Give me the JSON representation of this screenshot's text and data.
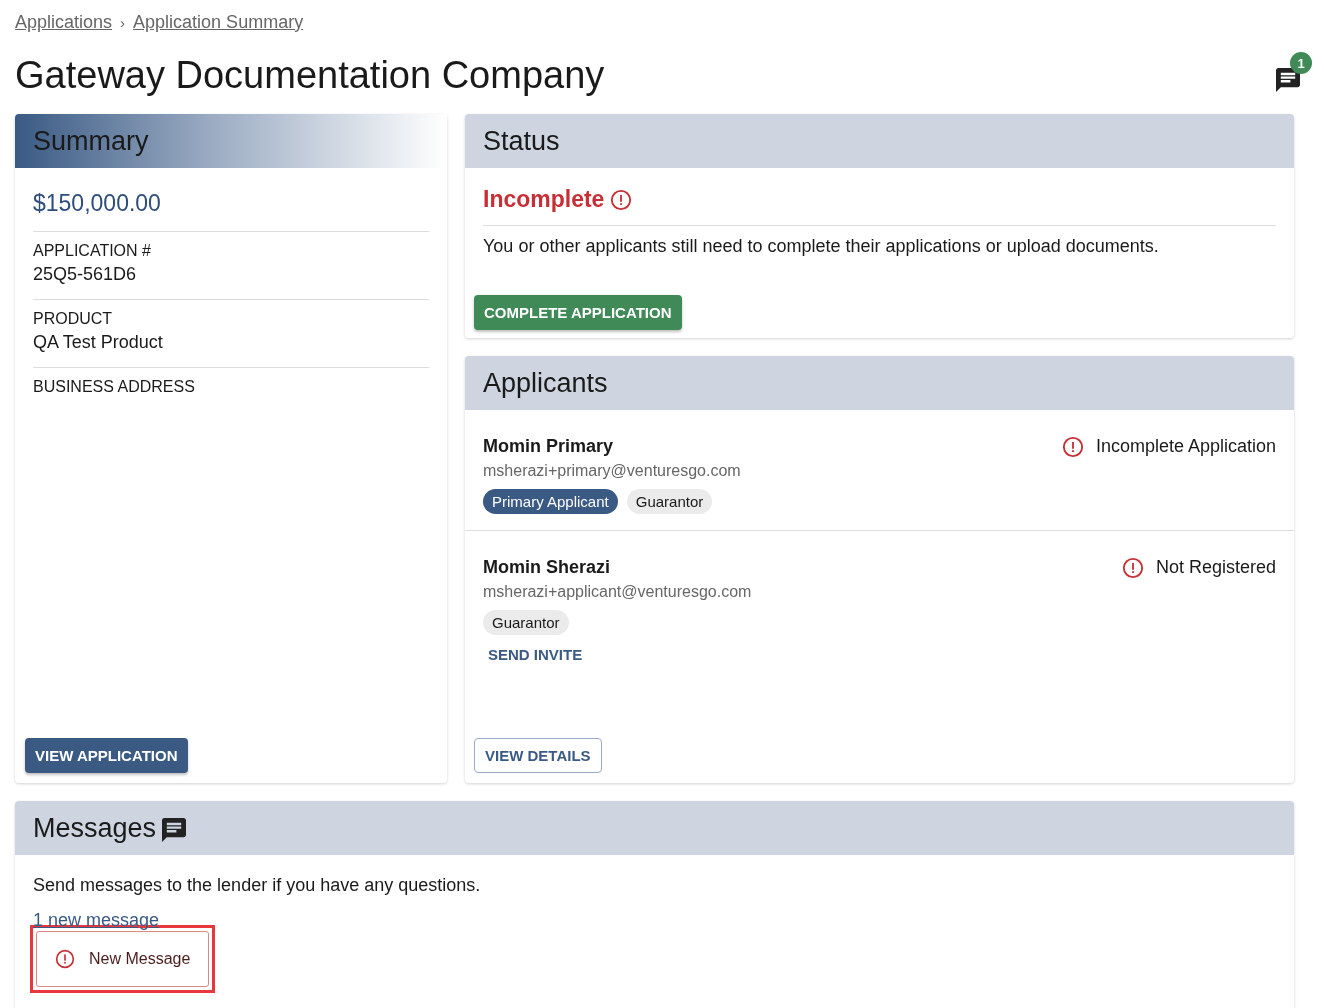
{
  "breadcrumbs": [
    {
      "label": "Applications"
    },
    {
      "label": "Application Summary"
    }
  ],
  "breadcrumb_separator": "›",
  "title": "Gateway Documentation Company",
  "messages_badge": "1",
  "summary": {
    "title": "Summary",
    "amount": "$150,000.00",
    "fields": [
      {
        "label": "APPLICATION #",
        "value": "25Q5-561D6"
      },
      {
        "label": "PRODUCT",
        "value": "QA Test Product"
      },
      {
        "label": "BUSINESS ADDRESS"
      }
    ],
    "button": "VIEW APPLICATION"
  },
  "status": {
    "title": "Status",
    "state": "Incomplete",
    "description": "You or other applicants still need to complete their applications or upload documents.",
    "button": "COMPLETE APPLICATION"
  },
  "applicants": {
    "title": "Applicants",
    "items": [
      {
        "name": "Momin Primary",
        "email": "msherazi+primary@venturesgo.com",
        "status": "Incomplete Application",
        "tags": [
          {
            "label": "Primary Applicant",
            "kind": "primary"
          },
          {
            "label": "Guarantor",
            "kind": "default"
          }
        ]
      },
      {
        "name": "Momin Sherazi",
        "email": "msherazi+applicant@venturesgo.com",
        "status": "Not Registered",
        "tags": [
          {
            "label": "Guarantor",
            "kind": "default"
          }
        ],
        "action": "SEND INVITE"
      }
    ],
    "button": "VIEW DETAILS"
  },
  "messages": {
    "title": "Messages",
    "description": "Send messages to the lender if you have any questions.",
    "new_count": "1 new message",
    "button": "New Message",
    "highlighted": true
  }
}
